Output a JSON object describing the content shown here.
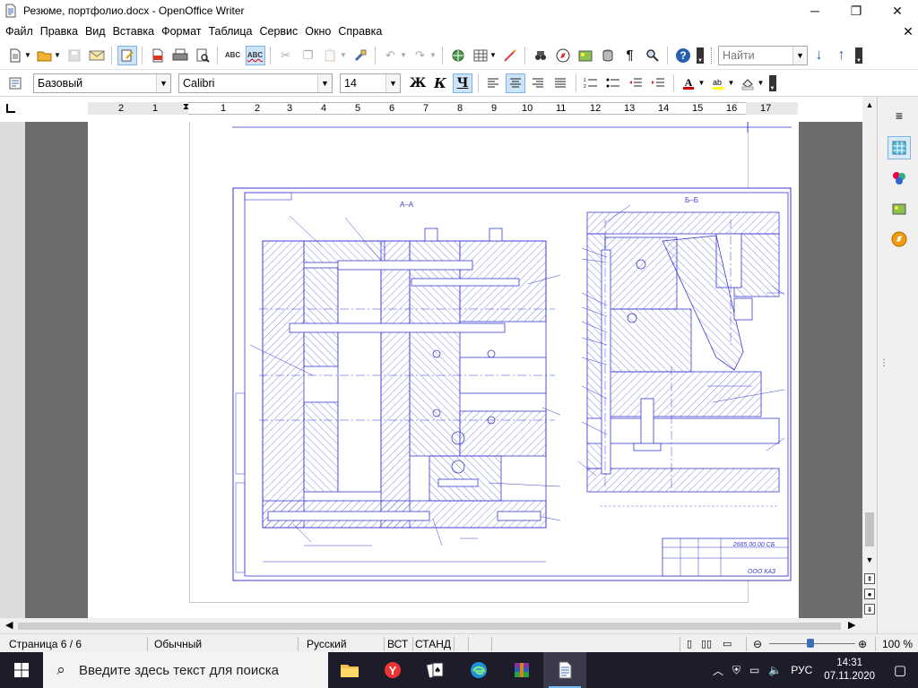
{
  "window": {
    "title": "Резюме, портфолио.docx - OpenOffice Writer",
    "minimize_glyph": "─",
    "maximize_glyph": "❐",
    "close_glyph": "✕",
    "doc_close_glyph": "✕"
  },
  "menu": {
    "items": [
      {
        "label": "Файл"
      },
      {
        "label": "Правка"
      },
      {
        "label": "Вид"
      },
      {
        "label": "Вставка"
      },
      {
        "label": "Формат"
      },
      {
        "label": "Таблица"
      },
      {
        "label": "Сервис"
      },
      {
        "label": "Окно"
      },
      {
        "label": "Справка"
      }
    ]
  },
  "toolbar": {
    "search_placeholder": "Найти"
  },
  "formatting": {
    "paragraph_style": "Базовый",
    "font_name": "Calibri",
    "font_size": "14",
    "bold_label": "Ж",
    "italic_label": "К",
    "underline_label": "Ч"
  },
  "ruler": {
    "numbers": [
      "2",
      "1",
      "1",
      "2",
      "3",
      "4",
      "5",
      "6",
      "7",
      "8",
      "9",
      "10",
      "11",
      "12",
      "13",
      "14",
      "15",
      "16",
      "17"
    ]
  },
  "drawing": {
    "section_a": "А–А",
    "section_b": "Б–Б",
    "doc_code": "2665.00.00 СБ",
    "company": "ООО КАЗ"
  },
  "status": {
    "page": "Страница  6 / 6",
    "style": "Обычный",
    "language": "Русский",
    "insert_mode": "ВСТ",
    "selection_mode": "СТАНД",
    "zoom": "100 %"
  },
  "taskbar": {
    "search_placeholder": "Введите здесь текст для поиска",
    "lang": "РУС",
    "time": "14:31",
    "date": "07.11.2020"
  },
  "colors": {
    "drawing_line": "#3a3ad0",
    "accent": "#3b6fb6",
    "taskbar": "#1c1c2b"
  }
}
